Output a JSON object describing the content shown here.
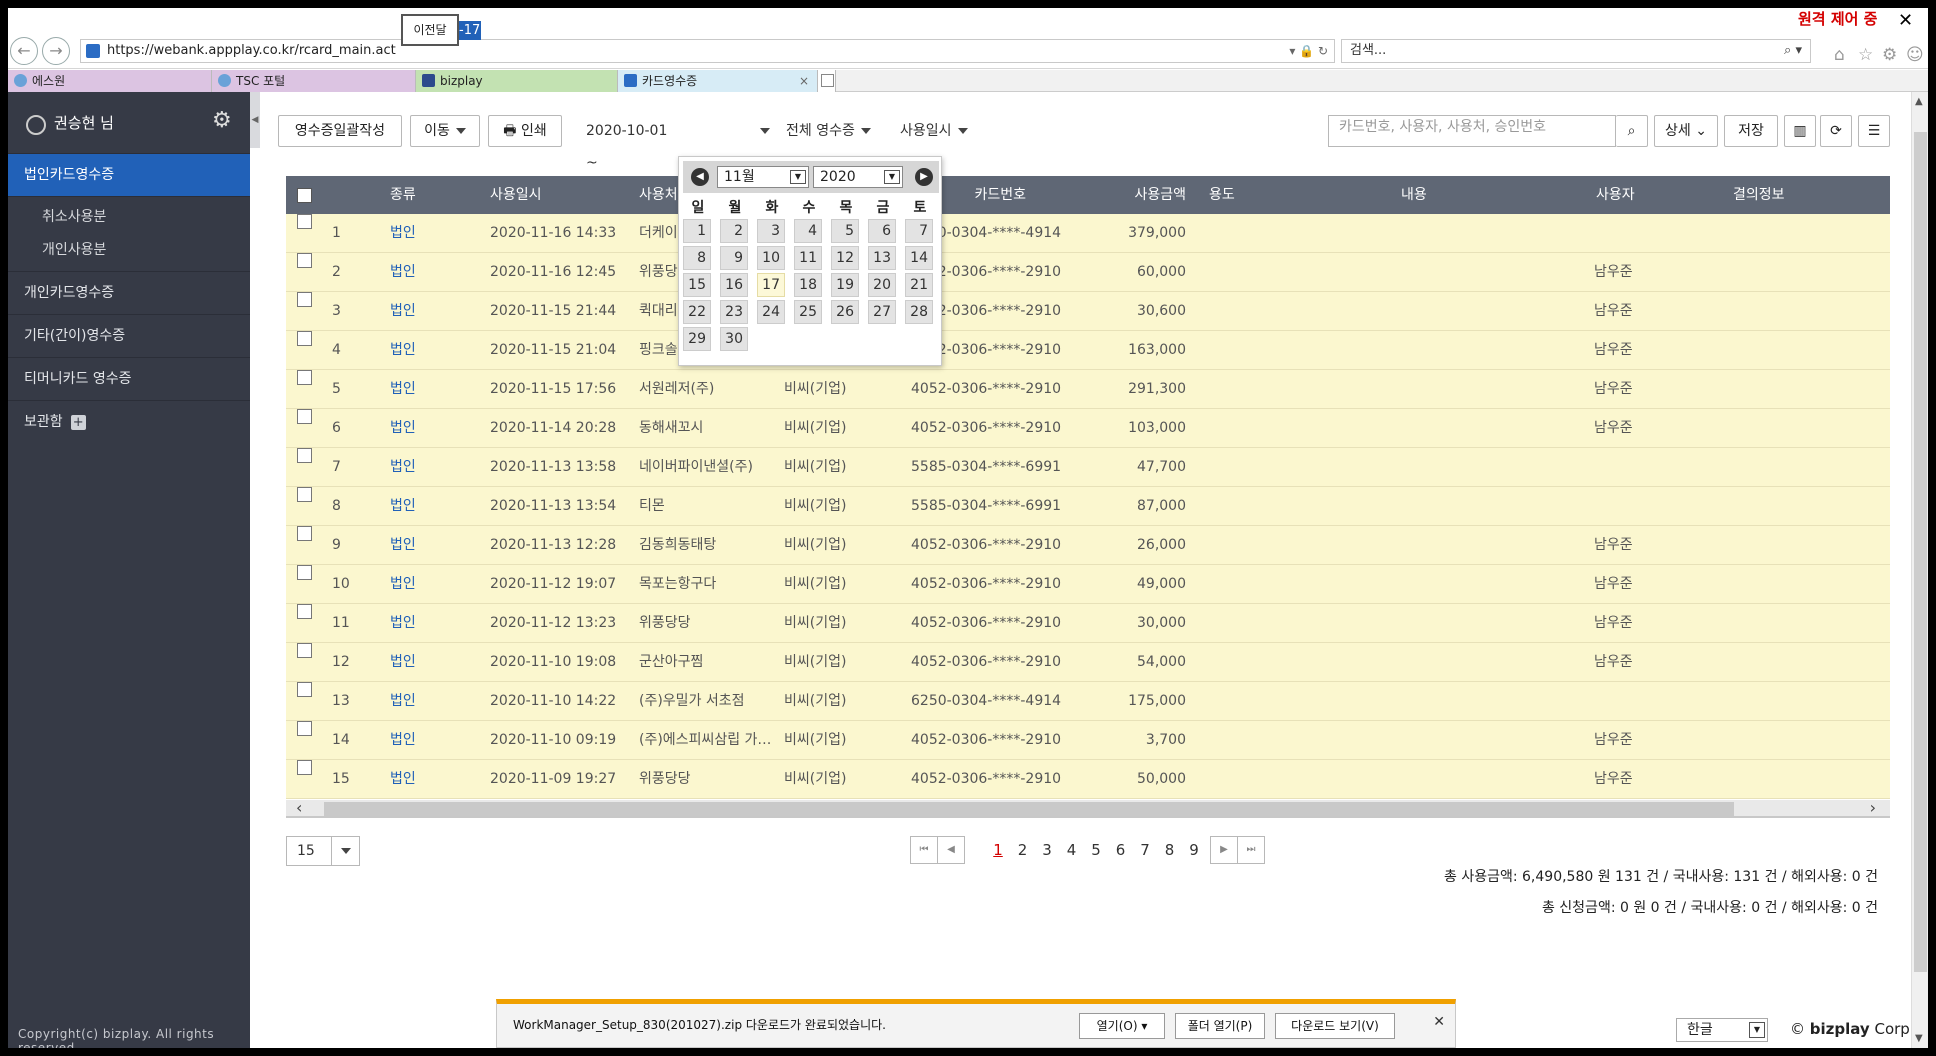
{
  "browser": {
    "url": "https://webank.appplay.co.kr/rcard_main.act",
    "search_placeholder": "검색...",
    "remote_label": "원격 제어 중",
    "tabs": [
      {
        "label": "에스원",
        "color": "#d9b8de"
      },
      {
        "label": "TSC 포털",
        "color": "#d9b8de"
      },
      {
        "label": "bizplay",
        "color": "#bfe0b0"
      },
      {
        "label": "카드영수증",
        "color": "#d7ecf6"
      }
    ]
  },
  "sidebar": {
    "user_name": "권승현 님",
    "menu": [
      {
        "label": "법인카드영수증",
        "active": true
      },
      {
        "label": "취소사용분",
        "sub": true
      },
      {
        "label": "개인사용분",
        "sub": true
      },
      {
        "label": "개인카드영수증"
      },
      {
        "label": "기타(간이)영수증"
      },
      {
        "label": "티머니카드 영수증"
      },
      {
        "label": "보관함"
      }
    ],
    "copyright": "Copyright(c) bizplay. All rights reserved."
  },
  "toolbar": {
    "bulk_btn": "영수증일괄작성",
    "move_btn": "이동",
    "print_btn": "인쇄",
    "date_start": "2020-10-01 ~",
    "prev_month": "이전달",
    "date_end_sel": "-17",
    "receipt_filter": "전체 영수증",
    "sort_field": "사용일시",
    "search_placeholder": "카드번호, 사용자, 사용처, 승인번호",
    "detail_btn": "상세",
    "save_btn": "저장"
  },
  "calendar": {
    "month": "11월",
    "year": "2020",
    "weekdays": [
      "일",
      "월",
      "화",
      "수",
      "목",
      "금",
      "토"
    ],
    "days_in_month": 30,
    "start_weekday": 0,
    "today": 17
  },
  "table": {
    "columns": [
      "종류",
      "사용일시",
      "사용처",
      "카드번호",
      "사용금액",
      "용도",
      "내용",
      "사용자",
      "결의정보"
    ],
    "rows": [
      {
        "no": "1",
        "type": "법인",
        "datetime": "2020-11-16 14:33",
        "merchant": "더케이",
        "category": "",
        "card": "6250-0304-****-4914",
        "amount": "379,000",
        "user": ""
      },
      {
        "no": "2",
        "type": "법인",
        "datetime": "2020-11-16 12:45",
        "merchant": "위풍당",
        "category": "",
        "card": "4052-0306-****-2910",
        "amount": "60,000",
        "user": "남우준"
      },
      {
        "no": "3",
        "type": "법인",
        "datetime": "2020-11-15 21:44",
        "merchant": "퀵대리",
        "category": "",
        "card": "4052-0306-****-2910",
        "amount": "30,600",
        "user": "남우준"
      },
      {
        "no": "4",
        "type": "법인",
        "datetime": "2020-11-15 21:04",
        "merchant": "핑크솔",
        "category": "",
        "card": "4052-0306-****-2910",
        "amount": "163,000",
        "user": "남우준"
      },
      {
        "no": "5",
        "type": "법인",
        "datetime": "2020-11-15 17:56",
        "merchant": "서원레저(주)",
        "category": "비씨(기업)",
        "card": "4052-0306-****-2910",
        "amount": "291,300",
        "user": "남우준"
      },
      {
        "no": "6",
        "type": "법인",
        "datetime": "2020-11-14 20:28",
        "merchant": "동해새꼬시",
        "category": "비씨(기업)",
        "card": "4052-0306-****-2910",
        "amount": "103,000",
        "user": "남우준"
      },
      {
        "no": "7",
        "type": "법인",
        "datetime": "2020-11-13 13:58",
        "merchant": "네이버파이낸셜(주)",
        "category": "비씨(기업)",
        "card": "5585-0304-****-6991",
        "amount": "47,700",
        "user": ""
      },
      {
        "no": "8",
        "type": "법인",
        "datetime": "2020-11-13 13:54",
        "merchant": "티몬",
        "category": "비씨(기업)",
        "card": "5585-0304-****-6991",
        "amount": "87,000",
        "user": ""
      },
      {
        "no": "9",
        "type": "법인",
        "datetime": "2020-11-13 12:28",
        "merchant": "김동희동태탕",
        "category": "비씨(기업)",
        "card": "4052-0306-****-2910",
        "amount": "26,000",
        "user": "남우준"
      },
      {
        "no": "10",
        "type": "법인",
        "datetime": "2020-11-12 19:07",
        "merchant": "목포는항구다",
        "category": "비씨(기업)",
        "card": "4052-0306-****-2910",
        "amount": "49,000",
        "user": "남우준"
      },
      {
        "no": "11",
        "type": "법인",
        "datetime": "2020-11-12 13:23",
        "merchant": "위풍당당",
        "category": "비씨(기업)",
        "card": "4052-0306-****-2910",
        "amount": "30,000",
        "user": "남우준"
      },
      {
        "no": "12",
        "type": "법인",
        "datetime": "2020-11-10 19:08",
        "merchant": "군산아구찜",
        "category": "비씨(기업)",
        "card": "4052-0306-****-2910",
        "amount": "54,000",
        "user": "남우준"
      },
      {
        "no": "13",
        "type": "법인",
        "datetime": "2020-11-10 14:22",
        "merchant": "(주)우밀가 서초점",
        "category": "비씨(기업)",
        "card": "6250-0304-****-4914",
        "amount": "175,000",
        "user": ""
      },
      {
        "no": "14",
        "type": "법인",
        "datetime": "2020-11-10 09:19",
        "merchant": "(주)에스피씨삼립 가…",
        "category": "비씨(기업)",
        "card": "4052-0306-****-2910",
        "amount": "3,700",
        "user": "남우준"
      },
      {
        "no": "15",
        "type": "법인",
        "datetime": "2020-11-09 19:27",
        "merchant": "위풍당당",
        "category": "비씨(기업)",
        "card": "4052-0306-****-2910",
        "amount": "50,000",
        "user": "남우준"
      }
    ]
  },
  "pager": {
    "page_size": "15",
    "pages": [
      "1",
      "2",
      "3",
      "4",
      "5",
      "6",
      "7",
      "8",
      "9"
    ],
    "current": "1"
  },
  "summary": {
    "line1": "총 사용금액: 6,490,580 원  131 건 / 국내사용: 131 건 / 해외사용: 0 건",
    "line2": "총 신청금액: 0 원 0 건 / 국내사용: 0 건 / 해외사용: 0 건"
  },
  "download": {
    "message": "WorkManager_Setup_830(201027).zip 다운로드가 완료되었습니다.",
    "open_btn": "열기(O)",
    "open_folder_btn": "폴더 열기(P)",
    "view_downloads_btn": "다운로드 보기(V)"
  },
  "footer": {
    "language": "한글",
    "brand_prefix": "© ",
    "brand_bold": "bizplay",
    "brand_suffix": " Corp."
  },
  "colors": {
    "sidebar_bg": "#363a46",
    "active_menu": "#2161b8",
    "row_bg": "#fbf7cf",
    "header_bg": "#5f6775"
  }
}
